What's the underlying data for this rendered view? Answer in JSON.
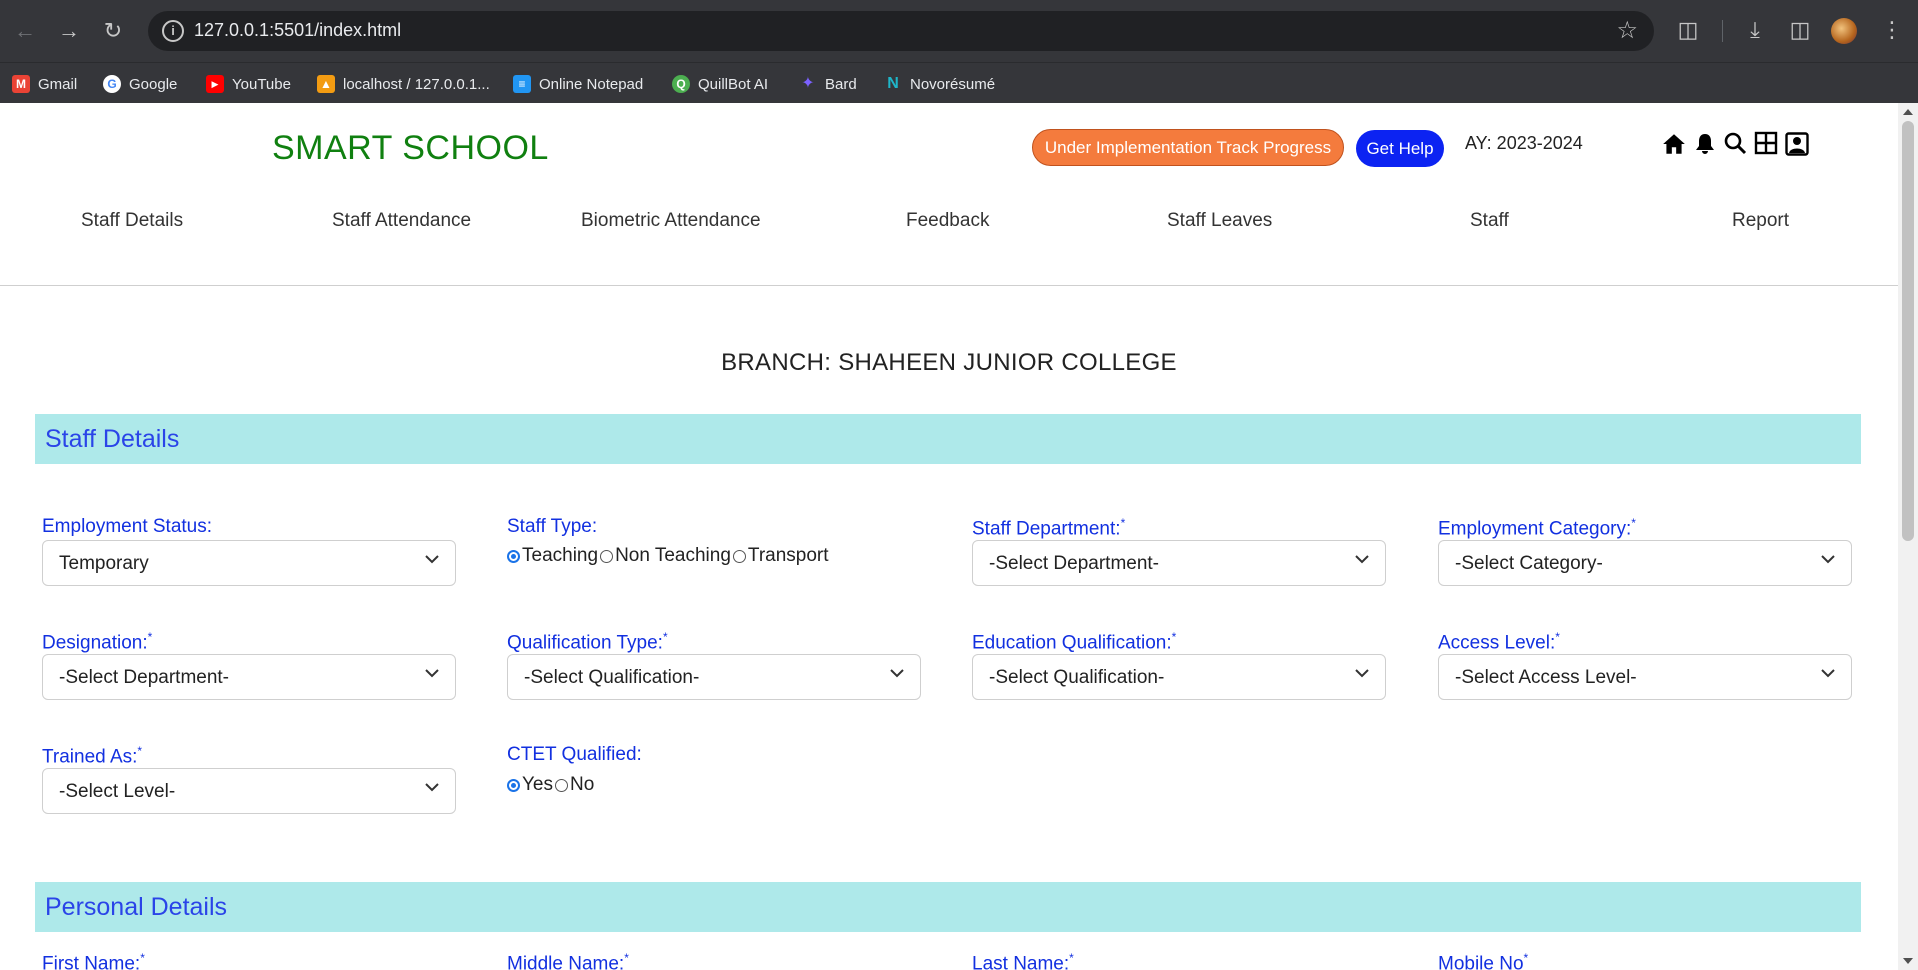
{
  "browser": {
    "url": "127.0.0.1:5501/index.html",
    "bookmarks": [
      {
        "label": "Gmail",
        "icon": "gmail-icon",
        "color": "#ea4335"
      },
      {
        "label": "Google",
        "icon": "google-icon",
        "color": "#4285f4"
      },
      {
        "label": "YouTube",
        "icon": "youtube-icon",
        "color": "#ff0000"
      },
      {
        "label": "localhost / 127.0.0.1...",
        "icon": "phpmyadmin-icon",
        "color": "#f39c12"
      },
      {
        "label": "Online Notepad",
        "icon": "notepad-icon",
        "color": "#2196f3"
      },
      {
        "label": "QuillBot AI",
        "icon": "quillbot-icon",
        "color": "#4caf50"
      },
      {
        "label": "Bard",
        "icon": "bard-icon",
        "color": "#7b61ff"
      },
      {
        "label": "Novorésumé",
        "icon": "novoresume-icon",
        "color": "#1fb6c9"
      }
    ]
  },
  "header": {
    "brand": "SMART SCHOOL",
    "progress_button": "Under Implementation Track Progress",
    "help_button": "Get Help",
    "academic_year": "AY: 2023-2024",
    "icons": [
      "home-icon",
      "bell-icon",
      "search-icon",
      "grid-icon",
      "profile-icon"
    ]
  },
  "menu": [
    "Staff Details",
    "Staff Attendance",
    "Biometric Attendance",
    "Feedback",
    "Staff Leaves",
    "Staff",
    "Report"
  ],
  "branch_title": "BRANCH: SHAHEEN JUNIOR COLLEGE",
  "sections": {
    "staff_details": "Staff Details",
    "personal_details": "Personal Details"
  },
  "form": {
    "employment_status": {
      "label": "Employment Status:",
      "value": "Temporary"
    },
    "staff_type": {
      "label": "Staff Type:",
      "options": [
        "Teaching",
        "Non Teaching",
        "Transport"
      ],
      "selected": "Teaching"
    },
    "staff_department": {
      "label": "Staff Department:",
      "required": "*",
      "value": "-Select Department-"
    },
    "employment_category": {
      "label": "Employment Category:",
      "required": "*",
      "value": "-Select Category-"
    },
    "designation": {
      "label": "Designation:",
      "required": "*",
      "value": "-Select Department-"
    },
    "qualification_type": {
      "label": "Qualification Type:",
      "required": "*",
      "value": "-Select Qualification-"
    },
    "education_qualification": {
      "label": "Education Qualification:",
      "required": "*",
      "value": "-Select Qualification-"
    },
    "access_level": {
      "label": "Access Level:",
      "required": "*",
      "value": "-Select Access Level-"
    },
    "trained_as": {
      "label": "Trained As:",
      "required": "*",
      "value": "-Select Level-"
    },
    "ctet_qualified": {
      "label": "CTET Qualified:",
      "options": [
        "Yes",
        "No"
      ],
      "selected": "Yes"
    },
    "first_name": {
      "label": "First Name:",
      "required": "*"
    },
    "middle_name": {
      "label": "Middle Name:",
      "required": "*"
    },
    "last_name": {
      "label": "Last Name:",
      "required": "*"
    },
    "mobile_no": {
      "label": "Mobile No",
      "required": "*"
    }
  },
  "colors": {
    "brand_green": "#108010",
    "progress_orange": "#f47b3d",
    "help_blue": "#0c23f2",
    "section_bg": "#aee9ea",
    "label_blue": "#1230e0"
  }
}
